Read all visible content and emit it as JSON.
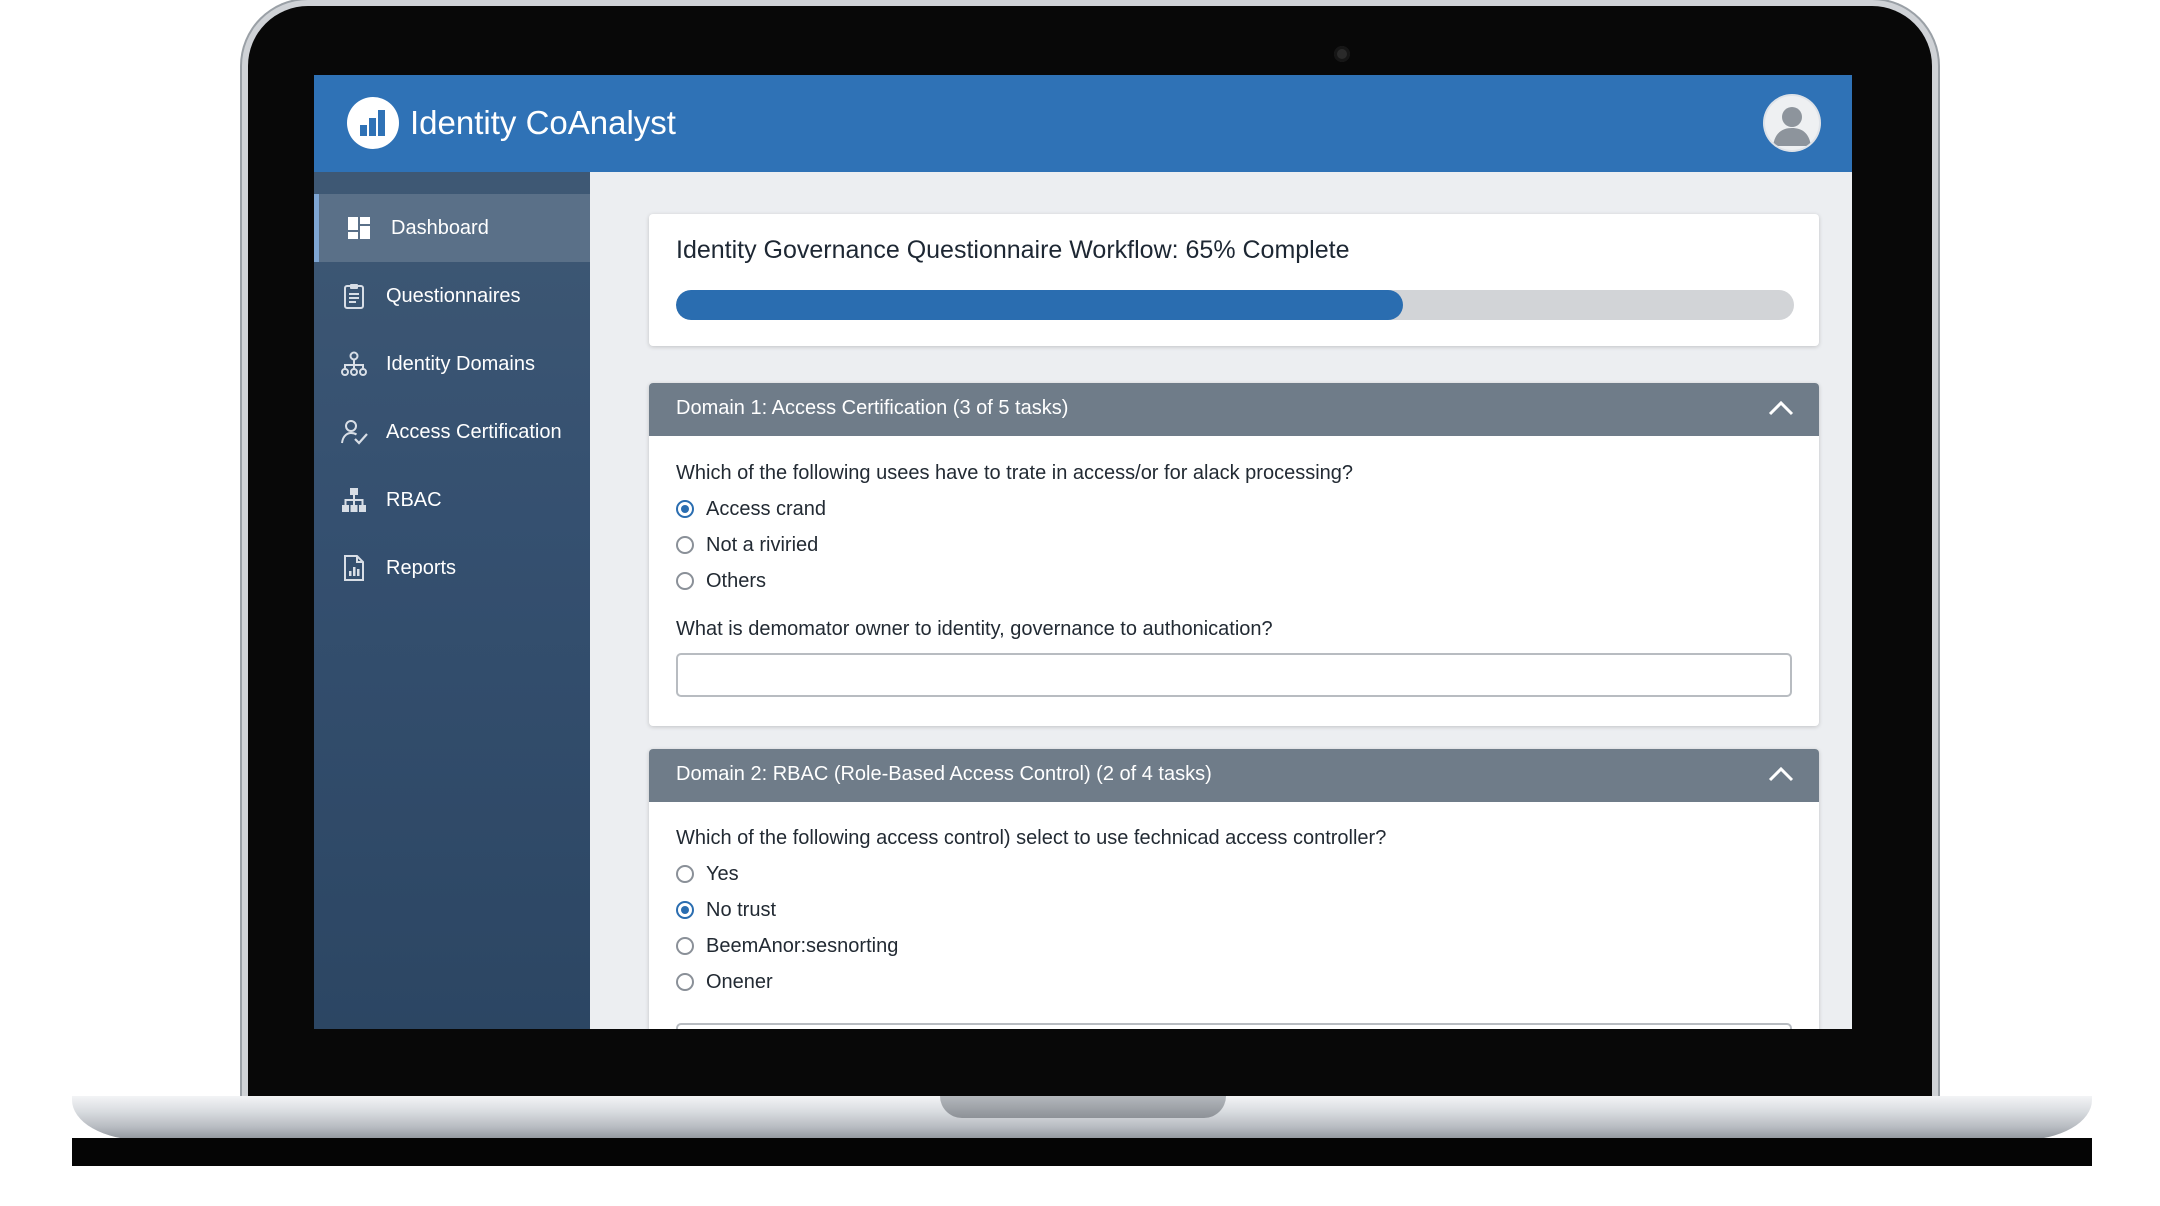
{
  "app": {
    "title": "Identity CoAnalyst"
  },
  "sidebar": {
    "items": [
      {
        "label": "Dashboard",
        "icon": "dashboard-icon",
        "active": true
      },
      {
        "label": "Questionnaires",
        "icon": "clipboard-icon",
        "active": false
      },
      {
        "label": "Identity Domains",
        "icon": "hierarchy-icon",
        "active": false
      },
      {
        "label": "Access Certification",
        "icon": "user-check-icon",
        "active": false
      },
      {
        "label": "RBAC",
        "icon": "org-chart-icon",
        "active": false
      },
      {
        "label": "Reports",
        "icon": "report-icon",
        "active": false
      }
    ]
  },
  "progress": {
    "title": "Identity Governance Questionnaire Workflow: 65% Complete",
    "percent": 65
  },
  "domains": [
    {
      "title": "Domain 1: Access Certification (3 of 5 tasks)",
      "questions": [
        {
          "text": "Which of the following usees have to trate in access/or for alack processing?",
          "type": "radio",
          "options": [
            "Access crand",
            "Not a riviried",
            "Others"
          ],
          "selected": 0
        },
        {
          "text": "What is demomator owner to identity, governance to authonication?",
          "type": "text",
          "value": "",
          "placeholder": ""
        }
      ]
    },
    {
      "title": "Domain 2: RBAC (Role-Based Access Control) (2 of 4 tasks)",
      "questions": [
        {
          "text": "Which of the following access control) select to use ƭechnicad access controller?",
          "type": "radio",
          "options": [
            "Yes",
            "No trust",
            "BeemAnor:sesnorting",
            "Onener"
          ],
          "selected": 1
        }
      ]
    }
  ],
  "colors": {
    "header": "#2f72b6",
    "sidebar": "#355070",
    "accent": "#2a6db0",
    "domain_header": "#6f7c89"
  }
}
